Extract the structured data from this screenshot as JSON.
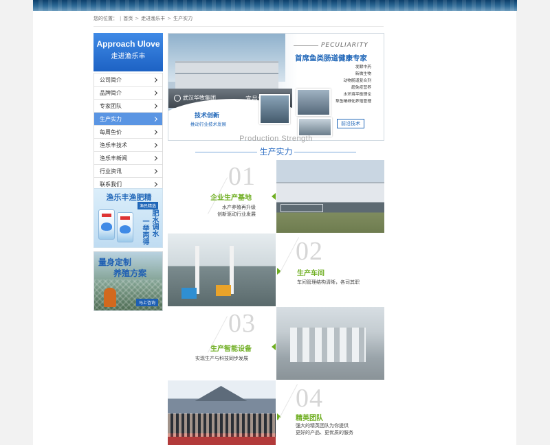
{
  "breadcrumb": {
    "label": "您的位置：",
    "items": [
      "首页",
      "走进渔乐丰",
      "生产实力"
    ]
  },
  "sidebar": {
    "title_en": "Approach Ulove",
    "title_cn": "走进渔乐丰",
    "items": [
      {
        "label": "公司简介",
        "active": false
      },
      {
        "label": "品牌简介",
        "active": false
      },
      {
        "label": "专家团队",
        "active": false
      },
      {
        "label": "生产实力",
        "active": true
      },
      {
        "label": "每周鱼价",
        "active": false
      },
      {
        "label": "渔乐丰技术",
        "active": false
      },
      {
        "label": "渔乐丰新闻",
        "active": false
      },
      {
        "label": "行业资讯",
        "active": false
      },
      {
        "label": "联系我们",
        "active": false
      }
    ],
    "ad1": {
      "title": "渔乐丰渔肥精",
      "tag": "渔民精选",
      "vertical1": "肥水调水",
      "vertical2": "一举两得"
    },
    "ad2": {
      "line1": "量身定制",
      "line2": "养殖方案",
      "button": "马上咨询"
    }
  },
  "hero": {
    "peculiarity": "PECULIARITY",
    "headline": "首席鱼类肠道健康专家",
    "features": [
      "发酵中药",
      "新微生物",
      "动物肠道复合剂",
      "超免疫营养",
      "水环境平衡理论",
      "草鱼精细化养殖管理"
    ],
    "button": "前沿技术",
    "tech_title": "技术创新",
    "tech_subtitle": "推动行业技术发展",
    "company": "武汉华牧集团",
    "slogan": "宜昌生物产业"
  },
  "production": {
    "title_en": "Production Strength",
    "title_cn": "生产实力",
    "sections": [
      {
        "num": "01",
        "title": "企业生产基地",
        "desc": [
          "水产养殖再升级",
          "创新驱动行业发展"
        ]
      },
      {
        "num": "02",
        "title": "生产车间",
        "desc": [
          "车间管理结构清晰，各司其职"
        ]
      },
      {
        "num": "03",
        "title": "生产智能设备",
        "desc": [
          "实现生产与科技同步发展"
        ]
      },
      {
        "num": "04",
        "title": "精英团队",
        "desc": [
          "强大的精英团队为你提供",
          "更好的产品、更优质的服务"
        ]
      }
    ]
  },
  "colors": {
    "accent_blue": "#2f6fc4",
    "active_nav": "#5a95e3",
    "title_green": "#6fae22"
  }
}
